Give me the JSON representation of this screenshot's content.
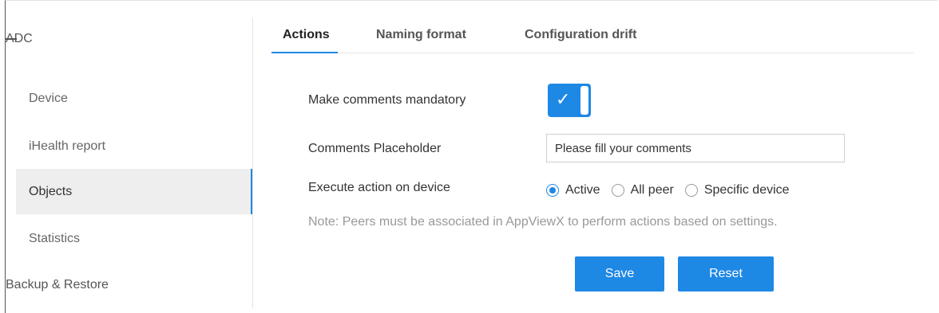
{
  "sidebar": {
    "section_title": "ADC",
    "items": [
      {
        "label": "Device"
      },
      {
        "label": "iHealth report"
      },
      {
        "label": "Objects",
        "active": true
      },
      {
        "label": "Statistics"
      }
    ],
    "footer_section": "Backup & Restore"
  },
  "tabs": [
    {
      "label": "Actions",
      "active": true
    },
    {
      "label": "Naming format"
    },
    {
      "label": "Configuration drift"
    }
  ],
  "form": {
    "mandatory_label": "Make comments mandatory",
    "mandatory_checked": true,
    "placeholder_label": "Comments Placeholder",
    "placeholder_value": "Please fill your comments",
    "execute_label": "Execute action on device",
    "execute_options": [
      {
        "label": "Active",
        "checked": true
      },
      {
        "label": "All peer",
        "checked": false
      },
      {
        "label": "Specific device",
        "checked": false
      }
    ],
    "note": "Note: Peers must be associated in AppViewX to perform actions based on settings.",
    "save_label": "Save",
    "reset_label": "Reset"
  },
  "colors": {
    "accent": "#1e88e5",
    "active_bg": "#eeeeee"
  }
}
